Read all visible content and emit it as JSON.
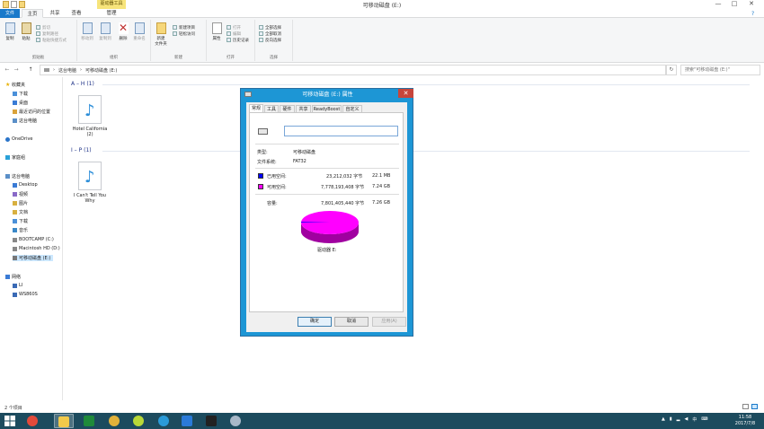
{
  "window": {
    "title": "可移动磁盘 (E:)",
    "context_tab_group": "驱动器工具",
    "controls": {
      "minimize": "—",
      "maximize": "□",
      "close": "✕"
    }
  },
  "ribbon_tabs": [
    "文件",
    "主页",
    "共享",
    "查看",
    "管理"
  ],
  "ribbon": {
    "clipboard": {
      "copy": "复制",
      "paste": "粘贴",
      "cut": "剪切",
      "copy_path": "复制路径",
      "paste_shortcut": "粘贴快捷方式",
      "label": "剪贴板"
    },
    "organize": {
      "move_to": "移动到",
      "copy_to": "复制到",
      "delete": "删除",
      "rename": "重命名",
      "label": "组织"
    },
    "new": {
      "new_folder": "新建\n文件夹",
      "new_item": "新建项目",
      "easy_access": "轻松访问",
      "label": "新建"
    },
    "open": {
      "properties": "属性",
      "open": "打开",
      "edit": "编辑",
      "history": "历史记录",
      "label": "打开"
    },
    "select": {
      "select_all": "全部选择",
      "select_none": "全部取消",
      "invert": "反向选择",
      "label": "选择"
    }
  },
  "address": {
    "back": "←",
    "forward": "→",
    "up": "↑",
    "crumbs": [
      "这台电脑",
      "可移动磁盘 (E:)"
    ],
    "refresh": "↻",
    "search_placeholder": "搜索\"可移动磁盘 (E:)\""
  },
  "nav": {
    "favorites": "收藏夹",
    "fav_items": [
      "下载",
      "桌面",
      "最近访问的位置",
      "这台电脑"
    ],
    "onedrive": "OneDrive",
    "homegroup": "家庭组",
    "this_pc": "这台电脑",
    "pc_items": [
      "Desktop",
      "视频",
      "图片",
      "文档",
      "下载",
      "音乐",
      "BOOTCAMP (C:)",
      "Macintosh HD (D:)",
      "可移动磁盘 (E:)"
    ],
    "network": "网络",
    "net_items": [
      "LI",
      "WS860S"
    ]
  },
  "content": {
    "groups": [
      {
        "header": "A – H (1)",
        "file": "Hotel California (2)"
      },
      {
        "header": "I – P (1)",
        "file": "I Can't Tell You Why"
      }
    ]
  },
  "status": {
    "count": "2 个项目"
  },
  "taskbar": {
    "time": "11:58",
    "date": "2017/7/8",
    "ime": "中"
  },
  "dialog": {
    "title": "可移动磁盘 (E:) 属性",
    "close": "✕",
    "tabs": [
      "常规",
      "工具",
      "硬件",
      "共享",
      "ReadyBoost",
      "自定义"
    ],
    "name_value": "",
    "type_label": "类型:",
    "type_value": "可移动磁盘",
    "fs_label": "文件系统:",
    "fs_value": "FAT32",
    "used_label": "已用空间:",
    "used_bytes": "23,212,032 字节",
    "used_size": "22.1 MB",
    "free_label": "可用空间:",
    "free_bytes": "7,778,193,408 字节",
    "free_size": "7.24 GB",
    "cap_label": "容量:",
    "cap_bytes": "7,801,405,440 字节",
    "cap_size": "7.26 GB",
    "drive_label": "驱动器 E:",
    "used_color": "#0000ff",
    "free_color": "#ff00ff",
    "used_fraction": 0.003,
    "ok": "确定",
    "cancel": "取消",
    "apply": "应用(A)"
  }
}
